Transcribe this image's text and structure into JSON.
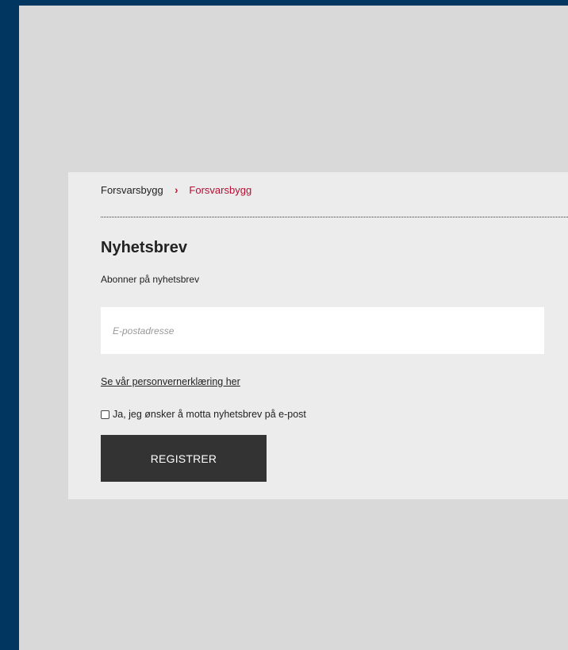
{
  "breadcrumb": {
    "items": [
      "Forsvarsbygg",
      "Forsvarsbygg"
    ],
    "separator": "›"
  },
  "newsletter": {
    "title": "Nyhetsbrev",
    "subtitle": "Abonner på nyhetsbrev",
    "email_placeholder": "E-postadresse",
    "email_value": "",
    "privacy_link": "Se vår personvernerklæring her",
    "consent_label": "Ja, jeg ønsker å motta nyhetsbrev på e-post",
    "consent_checked": false,
    "submit_label": "REGISTRER"
  },
  "colors": {
    "outer_background": "#003660",
    "page_background": "#d9d9d9",
    "card_background": "#ececec",
    "accent_red": "#b40f33",
    "button_background": "#333333"
  }
}
